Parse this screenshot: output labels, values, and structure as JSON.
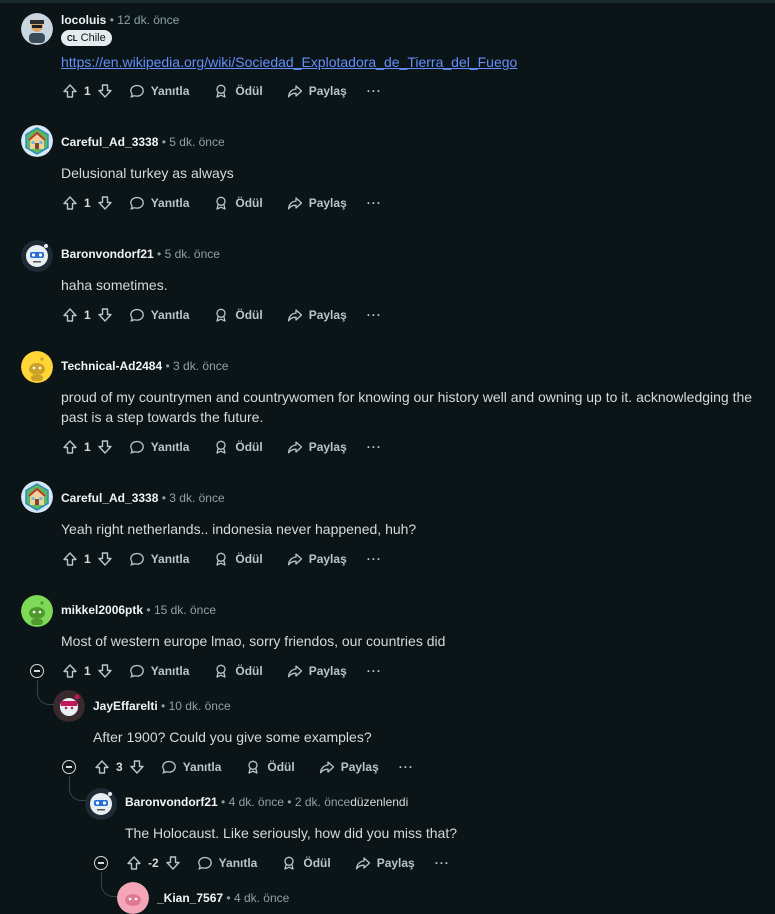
{
  "labels": {
    "reply": "Yanıtla",
    "award": "Ödül",
    "share": "Paylaş",
    "more": "···"
  },
  "comments": [
    {
      "user": "locoluis",
      "time": "12 dk. önce",
      "flair_cc": "CL",
      "flair": "Chile",
      "link": "https://en.wikipedia.org/wiki/Sociedad_Explotadora_de_Tierra_del_Fuego",
      "votes": "1"
    },
    {
      "user": "Careful_Ad_3338",
      "time": "5 dk. önce",
      "text": "Delusional turkey as always",
      "votes": "1"
    },
    {
      "user": "Baronvondorf21",
      "time": "5 dk. önce",
      "text": "haha sometimes.",
      "votes": "1"
    },
    {
      "user": "Technical-Ad2484",
      "time": "3 dk. önce",
      "text": "proud of my countrymen and countrywomen for knowing our history well and owning up to it. acknowledging the past is a step towards the future.",
      "votes": "1"
    },
    {
      "user": "Careful_Ad_3338",
      "time": "3 dk. önce",
      "text": "Yeah right netherlands.. indonesia never happened, huh?",
      "votes": "1"
    },
    {
      "user": "mikkel2006ptk",
      "time": "15 dk. önce",
      "text": "Most of western europe lmao, sorry friendos, our countries did",
      "votes": "1"
    },
    {
      "user": "JayEffarelti",
      "time": "10 dk. önce",
      "text": "After 1900? Could you give some examples?",
      "votes": "3"
    },
    {
      "user": "Baronvondorf21",
      "time": "4 dk. önce",
      "edited_time": "2 dk. önce",
      "edited_label": "düzenlendi",
      "text": "The Holocaust. Like seriously, how did you miss that?",
      "votes": "-2"
    },
    {
      "user": "_Kian_7567",
      "time": "4 dk. önce"
    }
  ],
  "colors": {
    "background": "#0b1416",
    "link": "#648efc",
    "username": "#f2f4f5",
    "meta": "#8ba2ad"
  },
  "icons": [
    "upvote-icon",
    "downvote-icon",
    "comment-bubble-icon",
    "award-icon",
    "share-arrow-icon",
    "more-dots-icon",
    "collapse-thread-icon"
  ]
}
